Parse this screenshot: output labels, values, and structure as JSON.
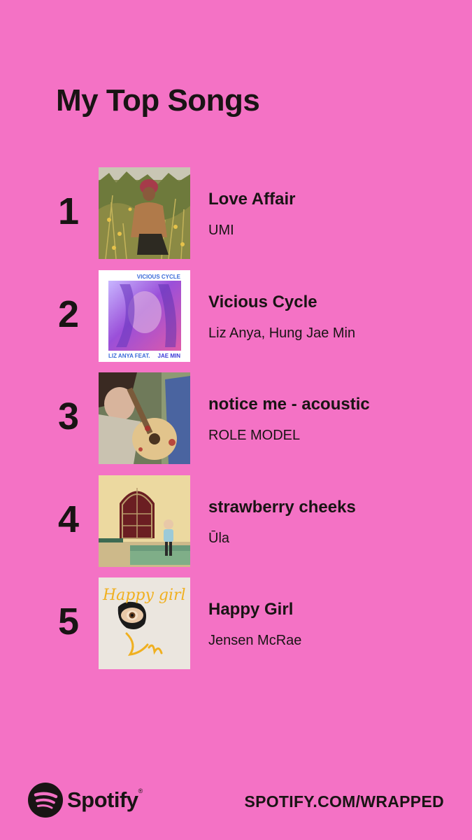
{
  "title": "My Top Songs",
  "songs": [
    {
      "rank": "1",
      "title": "Love Affair",
      "artist": "UMI"
    },
    {
      "rank": "2",
      "title": "Vicious Cycle",
      "artist": "Liz Anya, Hung Jae Min",
      "cover_text_top": "VICIOUS CYCLE",
      "cover_text_bottom": "LIZ ANYA FEAT.",
      "cover_text_bottom_2": "JAE MIN"
    },
    {
      "rank": "3",
      "title": "notice me - acoustic",
      "artist": "ROLE MODEL"
    },
    {
      "rank": "4",
      "title": "strawberry cheeks",
      "artist": "Ūla"
    },
    {
      "rank": "5",
      "title": "Happy Girl",
      "artist": "Jensen McRae",
      "cover_text": "Happy girl"
    }
  ],
  "footer": {
    "brand": "Spotify",
    "url": "SPOTIFY.COM/WRAPPED"
  },
  "colors": {
    "background": "#f472c5",
    "text": "#191414"
  },
  "icons": {
    "brand_logo": "spotify-logo-icon"
  }
}
